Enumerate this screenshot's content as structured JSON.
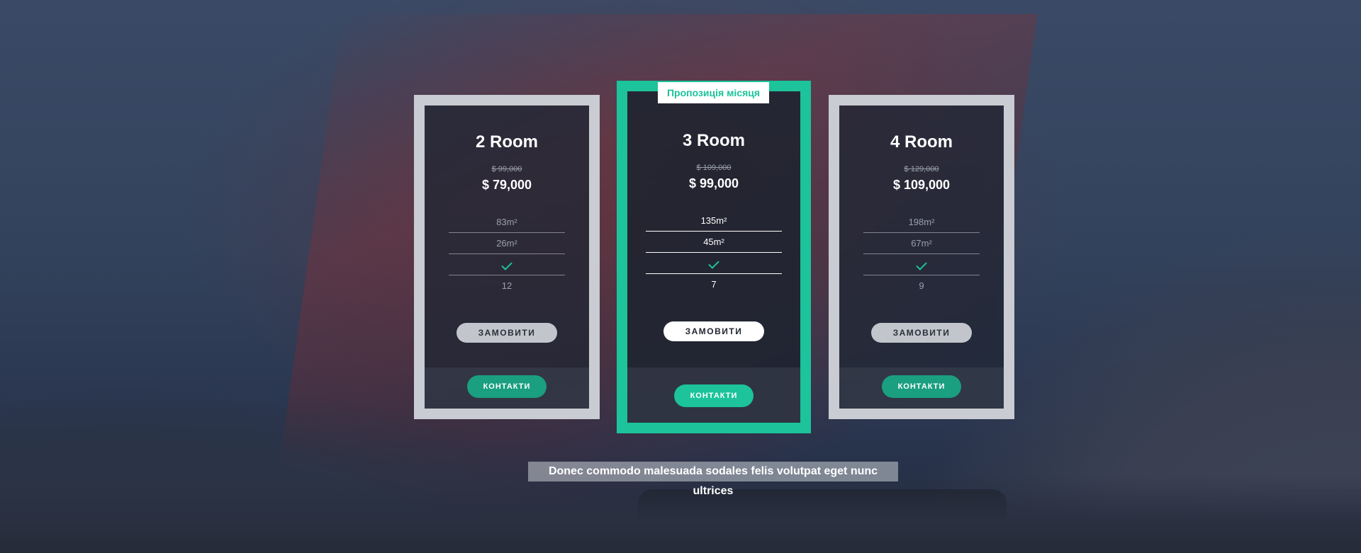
{
  "badge": "Пропозиція місяця",
  "caption": "Donec commodo malesuada sodales felis volutpat eget nunc ultrices",
  "colors": {
    "accent": "#1cc39b",
    "card_border": "#c9ccd2"
  },
  "cards": [
    {
      "title": "2 Room",
      "old_price": "$ 99,000",
      "price": "$ 79,000",
      "features": [
        "83m²",
        "26m²",
        "check-icon",
        "12"
      ],
      "order_label": "ЗАМОВИТИ",
      "contact_label": "КОНТАКТИ"
    },
    {
      "title": "3 Room",
      "old_price": "$ 109,000",
      "price": "$ 99,000",
      "features": [
        "135m²",
        "45m²",
        "check-icon",
        "7"
      ],
      "order_label": "ЗАМОВИТИ",
      "contact_label": "КОНТАКТИ"
    },
    {
      "title": "4 Room",
      "old_price": "$ 129,000",
      "price": "$ 109,000",
      "features": [
        "198m²",
        "67m²",
        "check-icon",
        "9"
      ],
      "order_label": "ЗАМОВИТИ",
      "contact_label": "КОНТАКТИ"
    }
  ]
}
